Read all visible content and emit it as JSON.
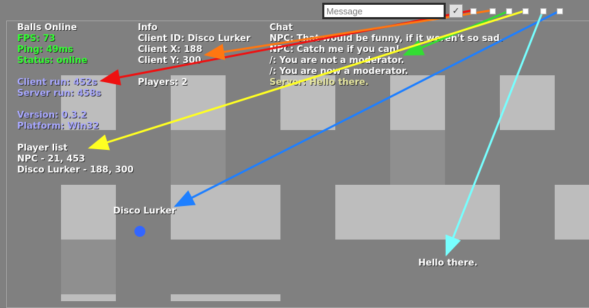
{
  "message_bar": {
    "placeholder": "Message",
    "send_label": "✓"
  },
  "stats": {
    "title": "Balls Online",
    "fps": "FPS: 73",
    "ping": "Ping: 49ms",
    "status": "Status: online",
    "client_run": "Client run: 452s",
    "server_run": "Server run: 458s",
    "version": "Version: 0.3.2",
    "platform": "Platform: Win32",
    "player_list_title": "Player list",
    "players": [
      "NPC - 21, 453",
      "Disco Lurker - 188, 300"
    ]
  },
  "info": {
    "title": "Info",
    "client_id": "Client ID: Disco Lurker",
    "client_x": "Client X: 188",
    "client_y": "Client Y: 300",
    "players": "Players: 2"
  },
  "chat": {
    "title": "Chat",
    "messages": [
      "NPC: That would be funny, if it weren't so sad.",
      "NPC: Catch me if you can!",
      "/: You are not a moderator.",
      "/: You are now a moderator.",
      "Server: Hello there."
    ]
  },
  "world": {
    "player_name": "Disco Lurker",
    "speech_bubble": "Hello there.",
    "player_color": "#3366ff"
  },
  "colors": {
    "background": "#808080",
    "tile": "#bdbdbd",
    "green_text": "#33ff33",
    "purple_text": "#a8a8ff",
    "server_text": "#e6e6a0",
    "arrow_red": "#ee1111",
    "arrow_orange": "#ff7711",
    "arrow_green": "#33dd33",
    "arrow_yellow": "#ffff22",
    "arrow_blue": "#1e7fff",
    "arrow_cyan": "#77ffff"
  }
}
